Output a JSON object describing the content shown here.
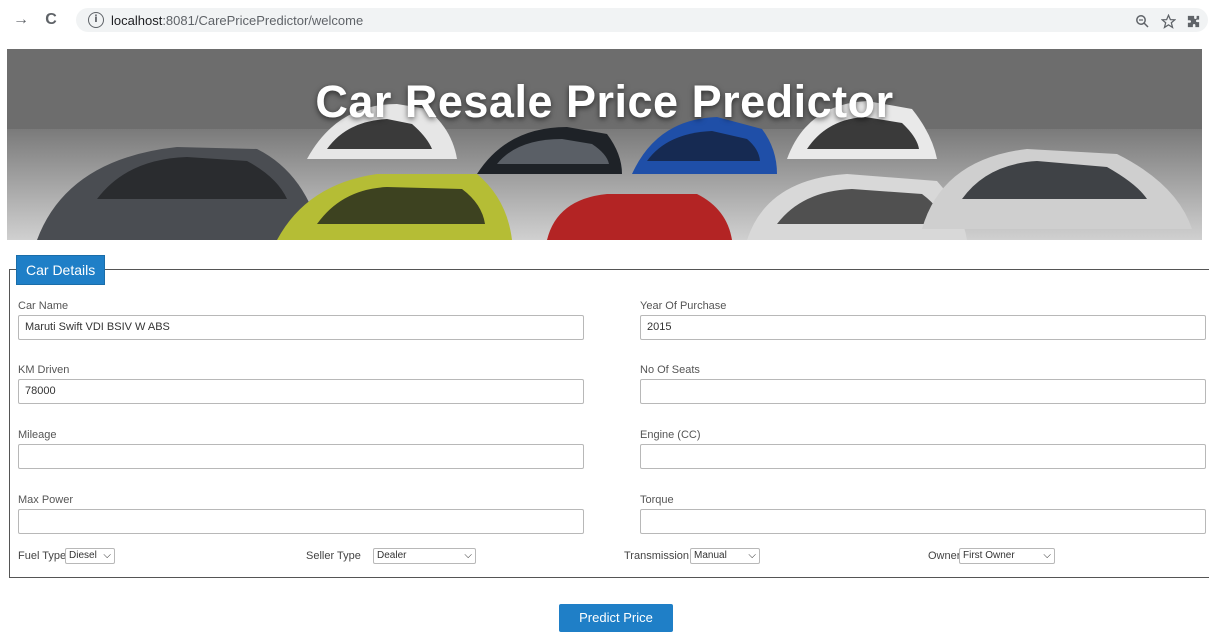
{
  "browser": {
    "url_host": "localhost",
    "url_path": ":8081/CarePricePredictor/welcome",
    "back_icon": "→",
    "reload_icon": "C",
    "info_icon": "i"
  },
  "hero": {
    "title": "Car Resale Price Predictor"
  },
  "form": {
    "legend": "Car Details",
    "fields": {
      "car_name": {
        "label": "Car Name",
        "value": "Maruti Swift VDI BSIV W ABS"
      },
      "year": {
        "label": "Year Of Purchase",
        "value": "2015"
      },
      "km_driven": {
        "label": "KM Driven",
        "value": "78000"
      },
      "seats": {
        "label": "No Of Seats",
        "value": ""
      },
      "mileage": {
        "label": "Mileage",
        "value": ""
      },
      "engine": {
        "label": "Engine (CC)",
        "value": ""
      },
      "max_power": {
        "label": "Max Power",
        "value": ""
      },
      "torque": {
        "label": "Torque",
        "value": ""
      }
    },
    "selects": {
      "fuel": {
        "label": "Fuel Type",
        "value": "Diesel"
      },
      "seller": {
        "label": "Seller Type",
        "value": "Dealer"
      },
      "transmission": {
        "label": "Transmission",
        "value": "Manual"
      },
      "owner": {
        "label": "Owner",
        "value": "First Owner"
      }
    },
    "submit_label": "Predict Price"
  },
  "colors": {
    "accent": "#1f7fc7"
  }
}
